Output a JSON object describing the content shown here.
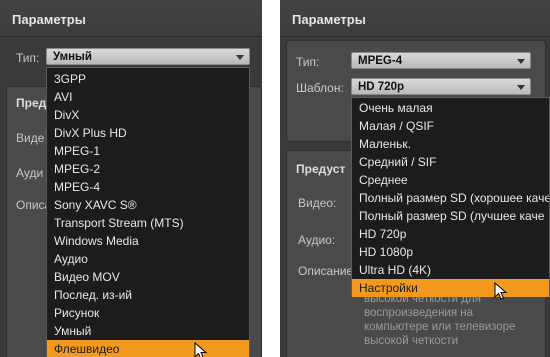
{
  "left": {
    "section_title": "Параметры",
    "type_label": "Тип:",
    "type_value": "Умный",
    "presets_partial": "Предс",
    "video_partial": "Виде",
    "audio_partial": "Ауди",
    "desc_partial": "Описа",
    "dropdown_items": [
      "3GPP",
      "AVI",
      "DivX",
      "DivX Plus HD",
      "MPEG-1",
      "MPEG-2",
      "MPEG-4",
      "Sony XAVC S®",
      "Transport Stream (MTS)",
      "Windows Media",
      "Аудио",
      "Видео MOV",
      "Послед. из-ий",
      "Рисунок",
      "Умный",
      "Флешвидео"
    ],
    "selected_index": 15
  },
  "right": {
    "section_title": "Параметры",
    "type_label": "Тип:",
    "type_value": "MPEG-4",
    "template_label": "Шаблон:",
    "template_value": "HD 720p",
    "presets_partial": "Предуст",
    "video_label": "Видео:",
    "audio_label": "Аудио:",
    "desc_label": "Описание",
    "dropdown_items": [
      "Очень малая",
      "Малая / QSIF",
      "Маленьк.",
      "Средний / SIF",
      "Среднее",
      "Полный размер SD (хорошее каче",
      "Полный размер SD (лучшее каче",
      "HD 720p",
      "HD 1080p",
      "Ultra HD (4K)",
      "Настройки"
    ],
    "selected_index": 10,
    "description_lines": [
      "высокой четкости для",
      "воспроизведения на",
      "компьютере или телевизоре",
      "высокой четкости"
    ]
  },
  "colors": {
    "panel_bg": "#3a3a3a",
    "dropdown_bg": "#1c1c1c",
    "highlight": "#f39a1e"
  }
}
